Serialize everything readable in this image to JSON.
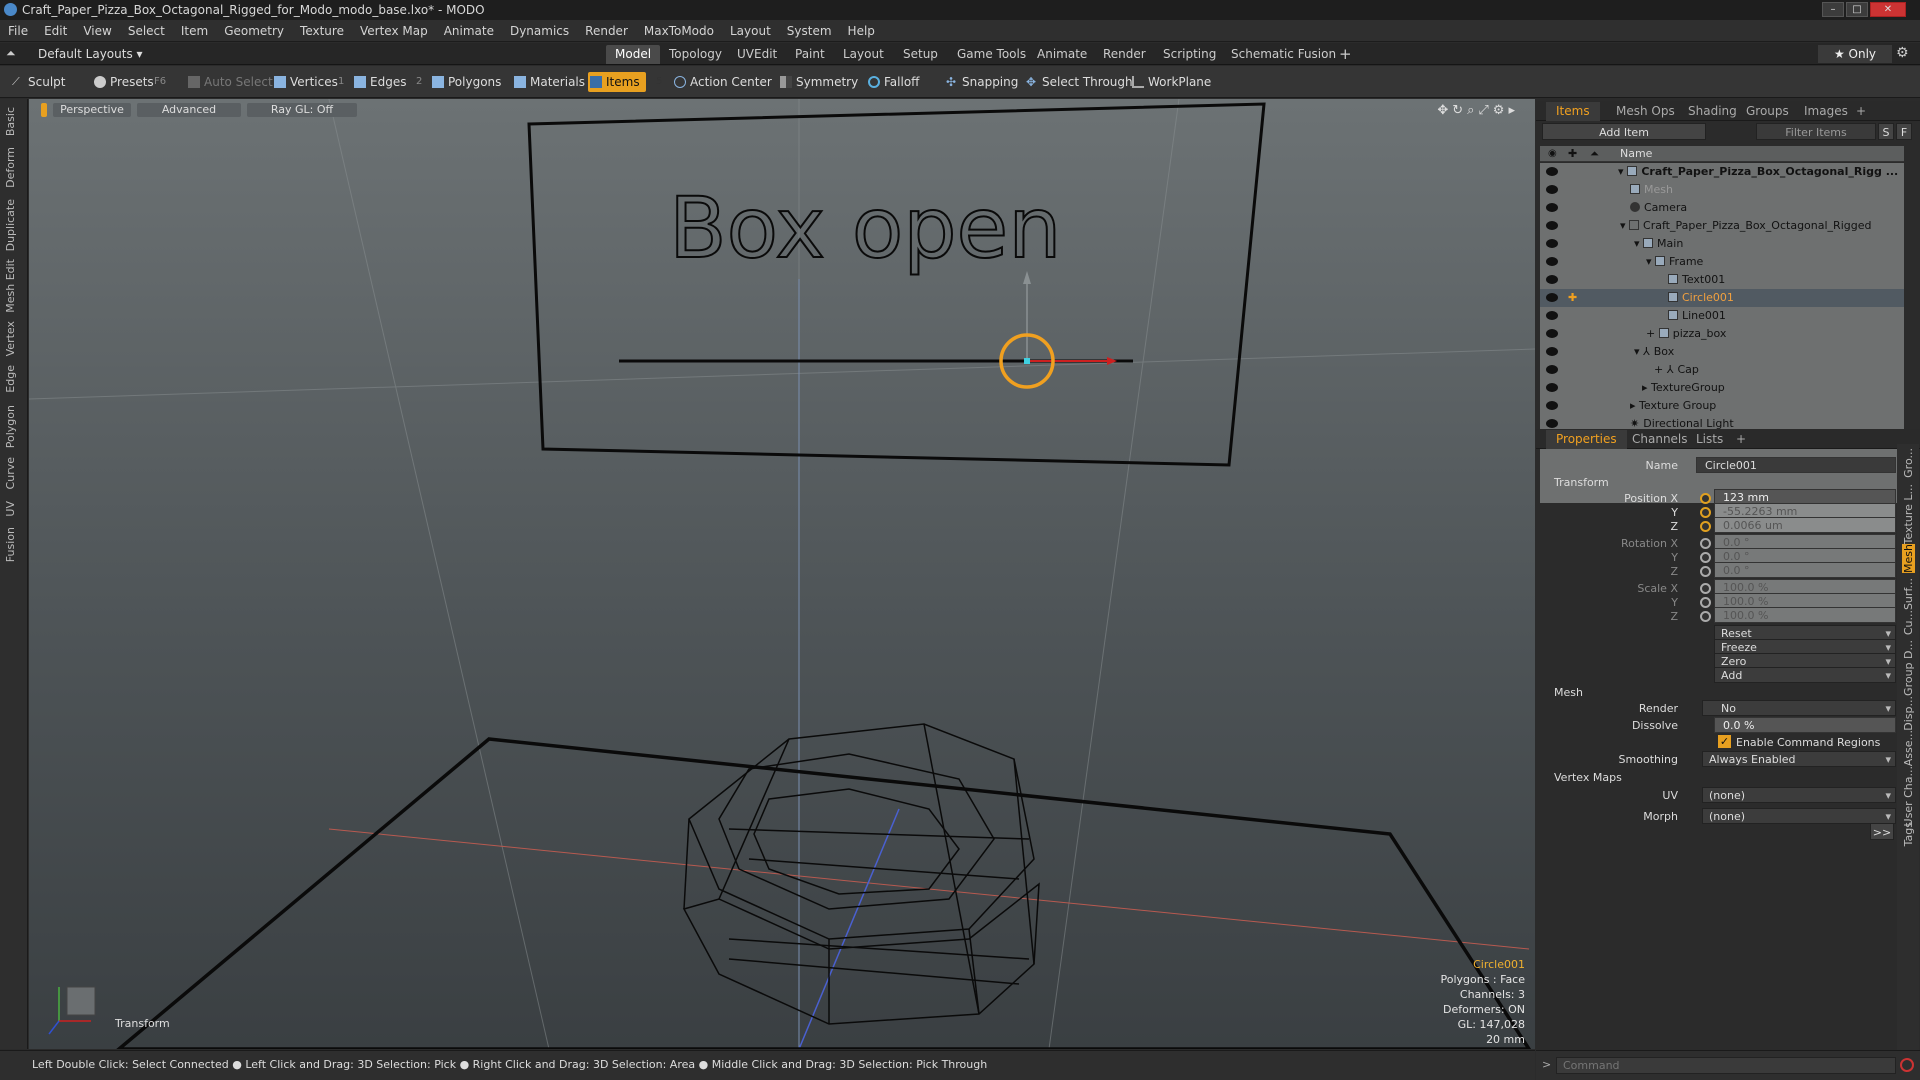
{
  "window": {
    "title": "Craft_Paper_Pizza_Box_Octagonal_Rigged_for_Modo_modo_base.lxo* - MODO"
  },
  "menu": [
    "File",
    "Edit",
    "View",
    "Select",
    "Item",
    "Geometry",
    "Texture",
    "Vertex Map",
    "Animate",
    "Dynamics",
    "Render",
    "MaxToModo",
    "Layout",
    "System",
    "Help"
  ],
  "layout_selector": "Default Layouts ▾",
  "layout_tabs": [
    "Model",
    "Topology",
    "UVEdit",
    "Paint",
    "Layout",
    "Setup",
    "Game Tools",
    "Animate",
    "Render",
    "Scripting",
    "Schematic Fusion",
    "+"
  ],
  "only_label": "★  Only",
  "toolbar": {
    "sculpt": "Sculpt",
    "presets": "Presets",
    "presets_key": "F6",
    "auto_select": "Auto Select",
    "vertices": "Vertices",
    "vertices_key": "1",
    "edges": "Edges",
    "edges_key": "2",
    "polygons": "Polygons",
    "materials": "Materials",
    "items": "Items",
    "items_key": "5",
    "action_center": "Action Center",
    "symmetry": "Symmetry",
    "falloff": "Falloff",
    "snapping": "Snapping",
    "select_through": "Select Through",
    "workplane": "WorkPlane"
  },
  "left_tabs": [
    "Basic",
    "Deform",
    "Duplicate",
    "Mesh Edit",
    "Vertex",
    "Edge",
    "Polygon",
    "Curve",
    "UV",
    "Fusion"
  ],
  "viewport": {
    "view": "Perspective",
    "shading": "Advanced",
    "raygl": "Ray GL: Off",
    "scene_text": "Box open",
    "info": {
      "selected": "Circle001",
      "polygons": "Polygons : Face",
      "channels": "Channels: 3",
      "deformers": "Deformers: ON",
      "gl": "GL: 147,028",
      "unit": "20 mm"
    },
    "transform_label": "Transform"
  },
  "status": "Left Double Click: Select Connected ● Left Click and Drag: 3D Selection: Pick ● Right Click and Drag: 3D Selection: Area ● Middle Click and Drag: 3D Selection: Pick Through",
  "items_panel": {
    "tabs": [
      "Items",
      "Mesh Ops",
      "Shading",
      "Groups",
      "Images",
      "+"
    ],
    "add_item": "Add Item",
    "filter": "Filter Items",
    "s_btn": "S",
    "f_btn": "F",
    "col_name": "Name",
    "tree": [
      {
        "label": "Craft_Paper_Pizza_Box_Octagonal_Rigg ...",
        "bold": true
      },
      {
        "label": "Mesh",
        "dim": true
      },
      {
        "label": "Camera"
      },
      {
        "label": "Craft_Paper_Pizza_Box_Octagonal_Rigged"
      },
      {
        "label": "Main"
      },
      {
        "label": "Frame"
      },
      {
        "label": "Text001"
      },
      {
        "label": "Circle001",
        "selected": true
      },
      {
        "label": "Line001"
      },
      {
        "label": "pizza_box"
      },
      {
        "label": "Box"
      },
      {
        "label": "Cap"
      },
      {
        "label": "TextureGroup"
      },
      {
        "label": "Texture Group"
      },
      {
        "label": "Directional Light"
      }
    ]
  },
  "properties_panel": {
    "tabs": [
      "Properties",
      "Channels",
      "Lists",
      "+"
    ],
    "name_label": "Name",
    "name_value": "Circle001",
    "transform_section": "Transform",
    "position_label": "Position X",
    "pos_x": "123 mm",
    "pos_y": "-55.2263 mm",
    "pos_z": "0.0066 um",
    "rotation_label": "Rotation X",
    "rot_x": "0.0 °",
    "rot_y": "0.0 °",
    "rot_z": "0.0 °",
    "scale_label": "Scale X",
    "scale_x": "100.0 %",
    "scale_y": "100.0 %",
    "scale_z": "100.0 %",
    "y_label": "Y",
    "z_label": "Z",
    "reset": "Reset",
    "freeze": "Freeze",
    "zero": "Zero",
    "add": "Add",
    "mesh_section": "Mesh",
    "render_label": "Render",
    "render_value": "No",
    "dissolve_label": "Dissolve",
    "dissolve_value": "0.0 %",
    "enable_cmd_regions": "Enable Command Regions",
    "smoothing_label": "Smoothing",
    "smoothing_value": "Always Enabled",
    "vertex_maps_section": "Vertex Maps",
    "uv_label": "UV",
    "uv_value": "(none)",
    "morph_label": "Morph",
    "morph_value": "(none)",
    "more": ">>"
  },
  "right_vtabs": [
    "Gro...",
    "Texture L...",
    "Mesh",
    "Surf...",
    "Cu...",
    "Group D...",
    "Disp...",
    "Asse...",
    "User Cha...",
    "Tags"
  ],
  "command_placeholder": "Command"
}
